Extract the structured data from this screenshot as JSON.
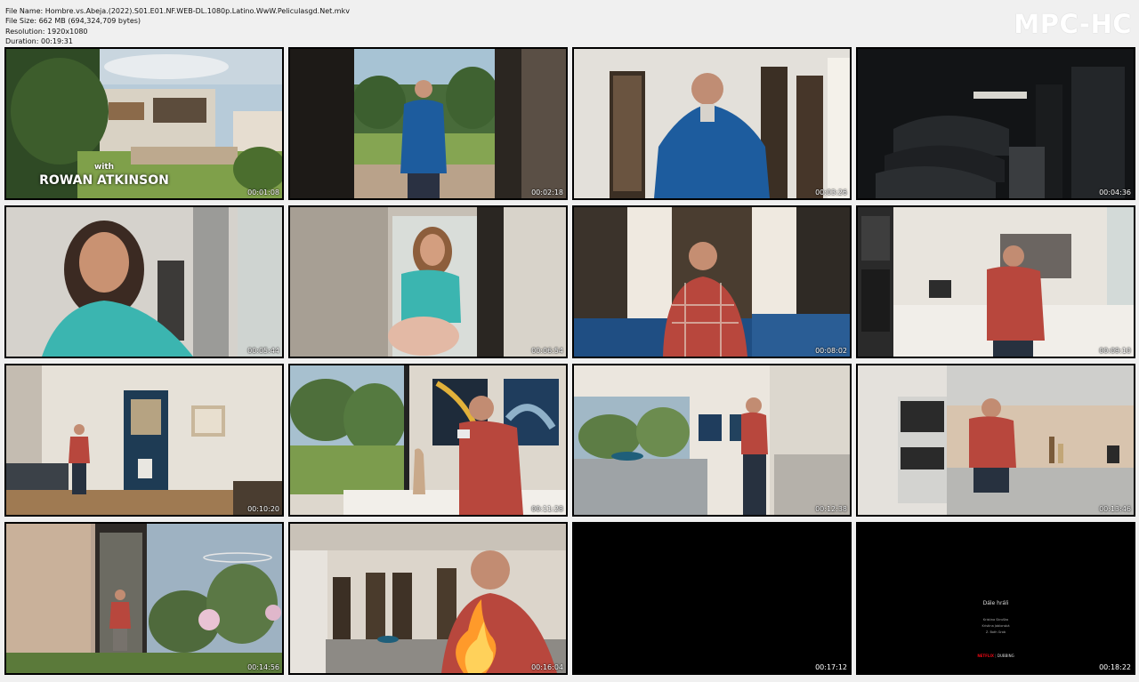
{
  "file_info": {
    "file_name": "File Name: Hombre.vs.Abeja.(2022).S01.E01.NF.WEB-DL.1080p.Latino.WwW.Peliculasgd.Net.mkv",
    "file_size": "File Size: 662 MB (694,324,709 bytes)",
    "resolution": "Resolution: 1920x1080",
    "duration": "Duration: 00:19:31"
  },
  "brand": "MPC-HC",
  "thumbnails": [
    {
      "time": "00:01:08"
    },
    {
      "time": "00:02:18"
    },
    {
      "time": "00:03:26"
    },
    {
      "time": "00:04:36"
    },
    {
      "time": "00:05:44"
    },
    {
      "time": "00:06:54"
    },
    {
      "time": "00:08:02"
    },
    {
      "time": "00:09:10"
    },
    {
      "time": "00:10:20"
    },
    {
      "time": "00:11:28"
    },
    {
      "time": "00:12:38"
    },
    {
      "time": "00:13:46"
    },
    {
      "time": "00:14:56"
    },
    {
      "time": "00:16:04"
    },
    {
      "time": "00:17:12"
    },
    {
      "time": "00:18:22"
    }
  ],
  "credits": {
    "with": "with",
    "name": "ROWAN ATKINSON"
  },
  "dubbing": {
    "title": "Dále hráli",
    "line1": "Kristina Skruška",
    "line2": "Kristina Jablonská",
    "line3": "Z. Both Grob",
    "netflix": "NETFLIX",
    "separator": "|",
    "dubbing_label": "DUBBING"
  },
  "colors": {
    "background": "#f0f0f0",
    "thumb_border": "#000000",
    "jacket_blue": "#1d5c9e",
    "teal": "#3bb5b0",
    "plaid": "#b8473d"
  }
}
